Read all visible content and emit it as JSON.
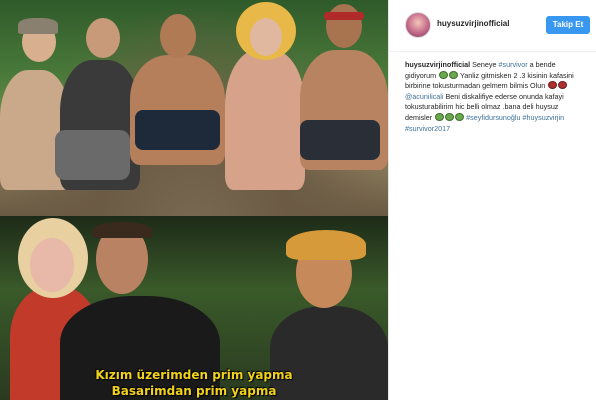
{
  "post": {
    "username": "huysuzvirjinofficial",
    "follow_label": "Takip Et",
    "caption": {
      "author": "huysuzvirjinofficial",
      "seg1": "Seneye",
      "tag1": "#survivor",
      "seg2": "a bende gidiyorum",
      "seg3": "Yanliz gitmisken 2 .3 kisinin kafasini birbirine tokusturmadan gelmem bilmis Olun",
      "mention": "@acunilicali",
      "seg4": "Beni diskalifiye ederse onunda kafayi tokusturabilirim hic belli olmaz .bana deli huysuz demisler",
      "tag2": "#seyfidursunoğlu",
      "tag3": "#huysuzvirjin",
      "tag4": "#survivor2017"
    }
  },
  "media": {
    "subtitle_line1": "Kızım üzerimden prim yapma",
    "subtitle_line2": "Basarimdan prim yapma"
  },
  "colors": {
    "follow_button": "#3897f0",
    "hashtag": "#3f729b",
    "subtitle": "#f2d21a"
  }
}
